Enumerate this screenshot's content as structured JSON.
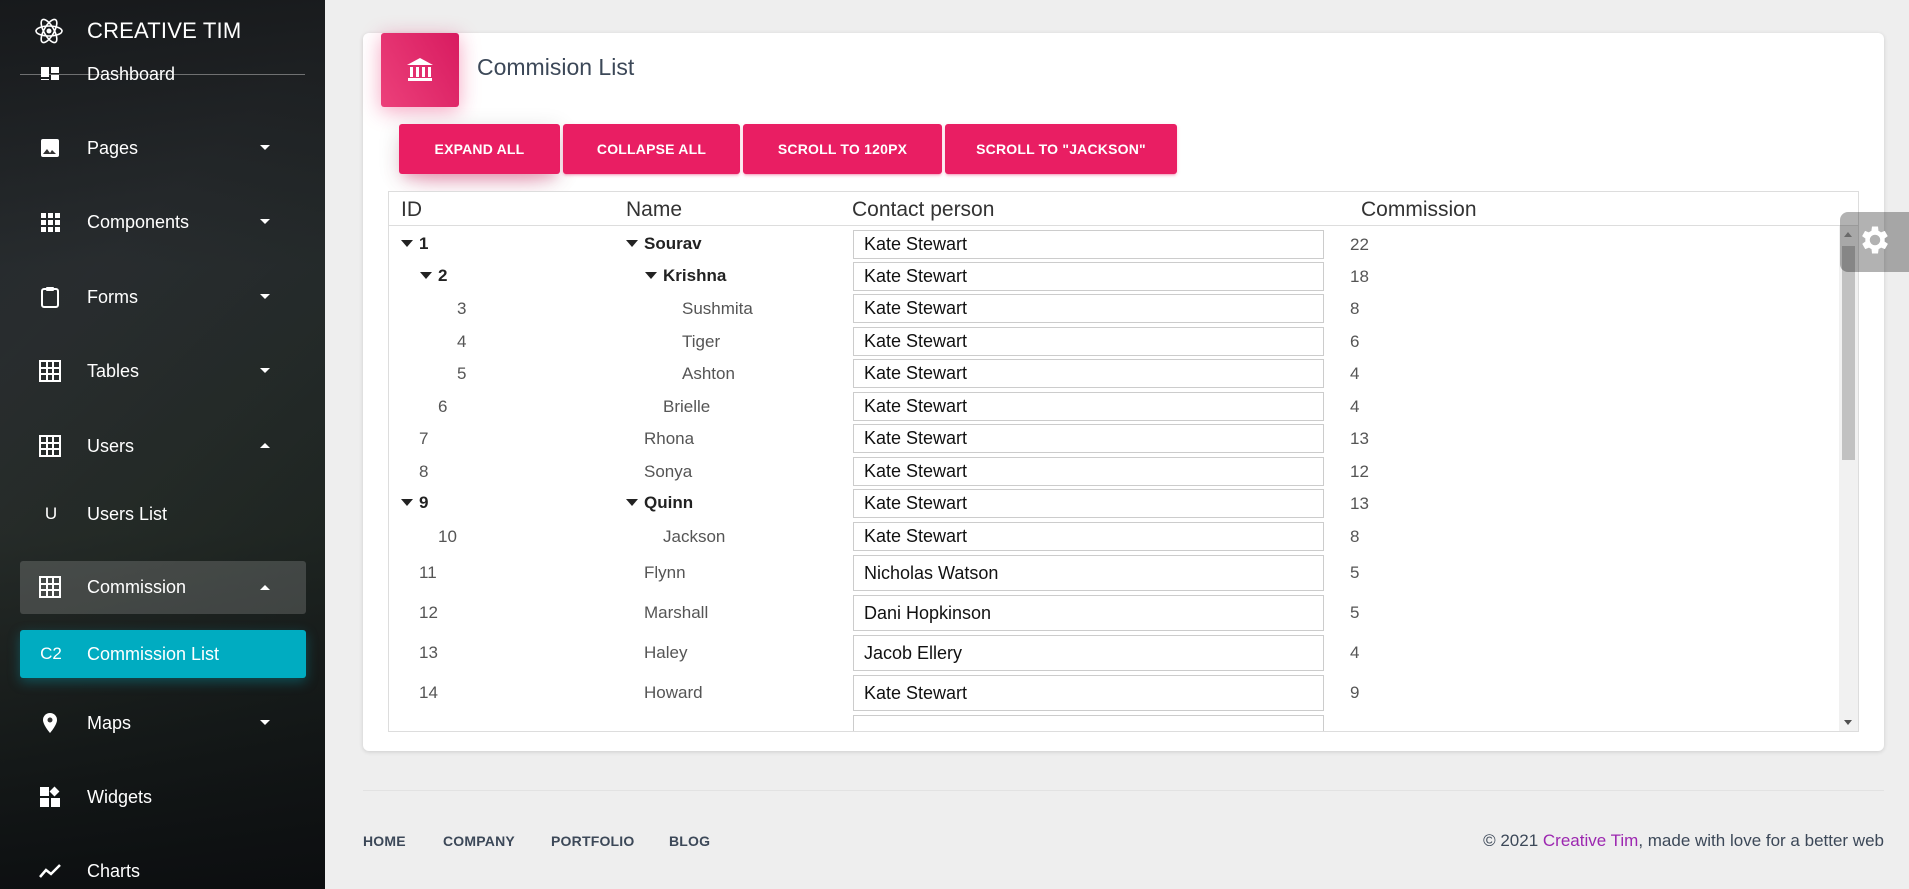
{
  "brand": {
    "name": "CREATIVE TIM"
  },
  "sidebar": {
    "items": [
      {
        "label": "Dashboard"
      },
      {
        "label": "Pages"
      },
      {
        "label": "Components"
      },
      {
        "label": "Forms"
      },
      {
        "label": "Tables"
      },
      {
        "label": "Users"
      },
      {
        "mini": "U",
        "label": "Users List"
      },
      {
        "label": "Commission"
      },
      {
        "mini": "C2",
        "label": "Commission List"
      },
      {
        "label": "Maps"
      },
      {
        "label": "Widgets"
      },
      {
        "label": "Charts"
      }
    ]
  },
  "card": {
    "title": "Commision List"
  },
  "toolbar": {
    "expand_all": "EXPAND ALL",
    "collapse_all": "COLLAPSE ALL",
    "scroll_px": "SCROLL TO 120PX",
    "scroll_name": "SCROLL TO \"JACKSON\""
  },
  "grid": {
    "columns": [
      "ID",
      "Name",
      "Contact person",
      "Commission"
    ],
    "rows": [
      {
        "id": "1",
        "name": "Sourav",
        "contact": "Kate Stewart",
        "commission": "22"
      },
      {
        "id": "2",
        "name": "Krishna",
        "contact": "Kate Stewart",
        "commission": "18"
      },
      {
        "id": "3",
        "name": "Sushmita",
        "contact": "Kate Stewart",
        "commission": "8"
      },
      {
        "id": "4",
        "name": "Tiger",
        "contact": "Kate Stewart",
        "commission": "6"
      },
      {
        "id": "5",
        "name": "Ashton",
        "contact": "Kate Stewart",
        "commission": "4"
      },
      {
        "id": "6",
        "name": "Brielle",
        "contact": "Kate Stewart",
        "commission": "4"
      },
      {
        "id": "7",
        "name": "Rhona",
        "contact": "Kate Stewart",
        "commission": "13"
      },
      {
        "id": "8",
        "name": "Sonya",
        "contact": "Kate Stewart",
        "commission": "12"
      },
      {
        "id": "9",
        "name": "Quinn",
        "contact": "Kate Stewart",
        "commission": "13"
      },
      {
        "id": "10",
        "name": "Jackson",
        "contact": "Kate Stewart",
        "commission": "8"
      },
      {
        "id": "11",
        "name": "Flynn",
        "contact": "Nicholas Watson",
        "commission": "5"
      },
      {
        "id": "12",
        "name": "Marshall",
        "contact": "Dani Hopkinson",
        "commission": "5"
      },
      {
        "id": "13",
        "name": "Haley",
        "contact": "Jacob Ellery",
        "commission": "4"
      },
      {
        "id": "14",
        "name": "Howard",
        "contact": "Kate Stewart",
        "commission": "9"
      }
    ]
  },
  "footer": {
    "links": [
      "HOME",
      "COMPANY",
      "PORTFOLIO",
      "BLOG"
    ],
    "copy_prefix": "© 2021 ",
    "copy_brand": "Creative Tim",
    "copy_suffix": ", made with love for a better web"
  },
  "colors": {
    "primary": "#e91e63",
    "active": "#00acc1",
    "brand_link": "#9c27b0"
  }
}
